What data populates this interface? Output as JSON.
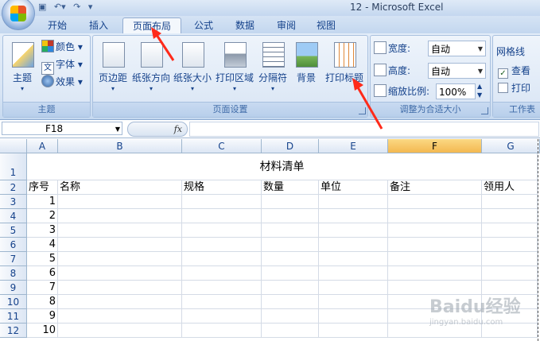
{
  "window": {
    "title": "12 - Microsoft Excel"
  },
  "tabs": [
    {
      "label": "开始",
      "active": false
    },
    {
      "label": "插入",
      "active": false
    },
    {
      "label": "页面布局",
      "active": true
    },
    {
      "label": "公式",
      "active": false
    },
    {
      "label": "数据",
      "active": false
    },
    {
      "label": "审阅",
      "active": false
    },
    {
      "label": "视图",
      "active": false
    }
  ],
  "ribbon": {
    "theme_group": {
      "label": "主题",
      "theme_button": "主题",
      "colors": "颜色",
      "fonts": "字体",
      "effects": "效果"
    },
    "page_setup_group": {
      "label": "页面设置",
      "margins": "页边距",
      "orientation": "纸张方向",
      "size": "纸张大小",
      "print_area": "打印区域",
      "breaks": "分隔符",
      "background": "背景",
      "print_titles": "打印标题"
    },
    "scale_group": {
      "label": "调整为合适大小",
      "width_label": "宽度:",
      "width_value": "自动",
      "height_label": "高度:",
      "height_value": "自动",
      "scale_label": "缩放比例:",
      "scale_value": "100%"
    },
    "sheet_options_group": {
      "label": "工作表",
      "gridlines": "网格线",
      "view": "查看",
      "print": "打印"
    }
  },
  "formula_bar": {
    "name_box": "F18",
    "fx": "fx",
    "content": ""
  },
  "grid": {
    "columns": [
      "A",
      "B",
      "C",
      "D",
      "E",
      "F",
      "G"
    ],
    "selected_column": "F",
    "rows": [
      "1",
      "2",
      "3",
      "4",
      "5",
      "6",
      "7",
      "8",
      "9",
      "10",
      "11",
      "12"
    ],
    "title": "材料清单",
    "headers": [
      "序号",
      "名称",
      "规格",
      "数量",
      "单位",
      "备注",
      "领用人"
    ],
    "serials": [
      "1",
      "2",
      "3",
      "4",
      "5",
      "6",
      "7",
      "8",
      "9",
      "10"
    ]
  },
  "watermark": {
    "brand": "Baidu经验",
    "url": "jingyan.baidu.com"
  }
}
